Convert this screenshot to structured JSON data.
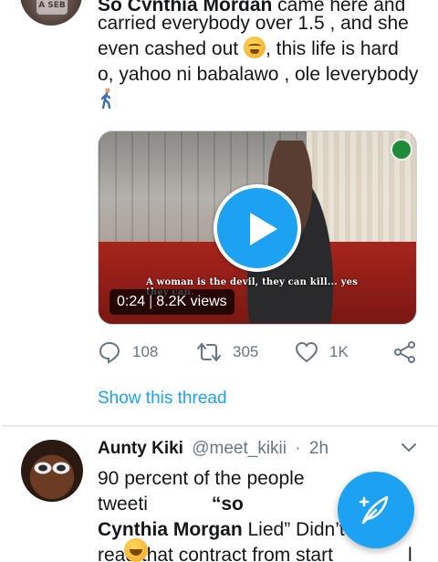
{
  "tweet1": {
    "text_line1_bold": "So Cynthia Morgan",
    "text_line1_rest": " came here and",
    "text_line2": "carried everybody over 1.5 , and she",
    "text_line3_a": "even cashed out ",
    "text_line3_b": ", this life is hard",
    "text_line4": "o, yahoo ni babalawo , ole leverybody",
    "emoji_1": "tired-face-emoji",
    "emoji_2": "person-walking-emoji",
    "video": {
      "subtitle": "A woman is the devil, they can kill... yes they can.",
      "duration": "0:24",
      "views": "8.2K views"
    },
    "actions": {
      "replies": "108",
      "retweets": "305",
      "likes": "1K"
    },
    "show_thread": "Show this thread"
  },
  "tweet2": {
    "name": "Aunty Kiki",
    "handle": "@meet_kikii",
    "dot": "·",
    "time": "2h",
    "line1_a": "90 percent of the people tweeti",
    "line1_b": "“so",
    "line2_bold": "Cynthia Morgan",
    "line2_rest": " Lied” Didn’t",
    "line3": "read that contract from start",
    "line3_end": "l",
    "emoji": "face-with-tears-of-joy-emoji"
  },
  "colors": {
    "accent": "#1da1f2",
    "text": "#14171a",
    "secondary": "#657786"
  }
}
